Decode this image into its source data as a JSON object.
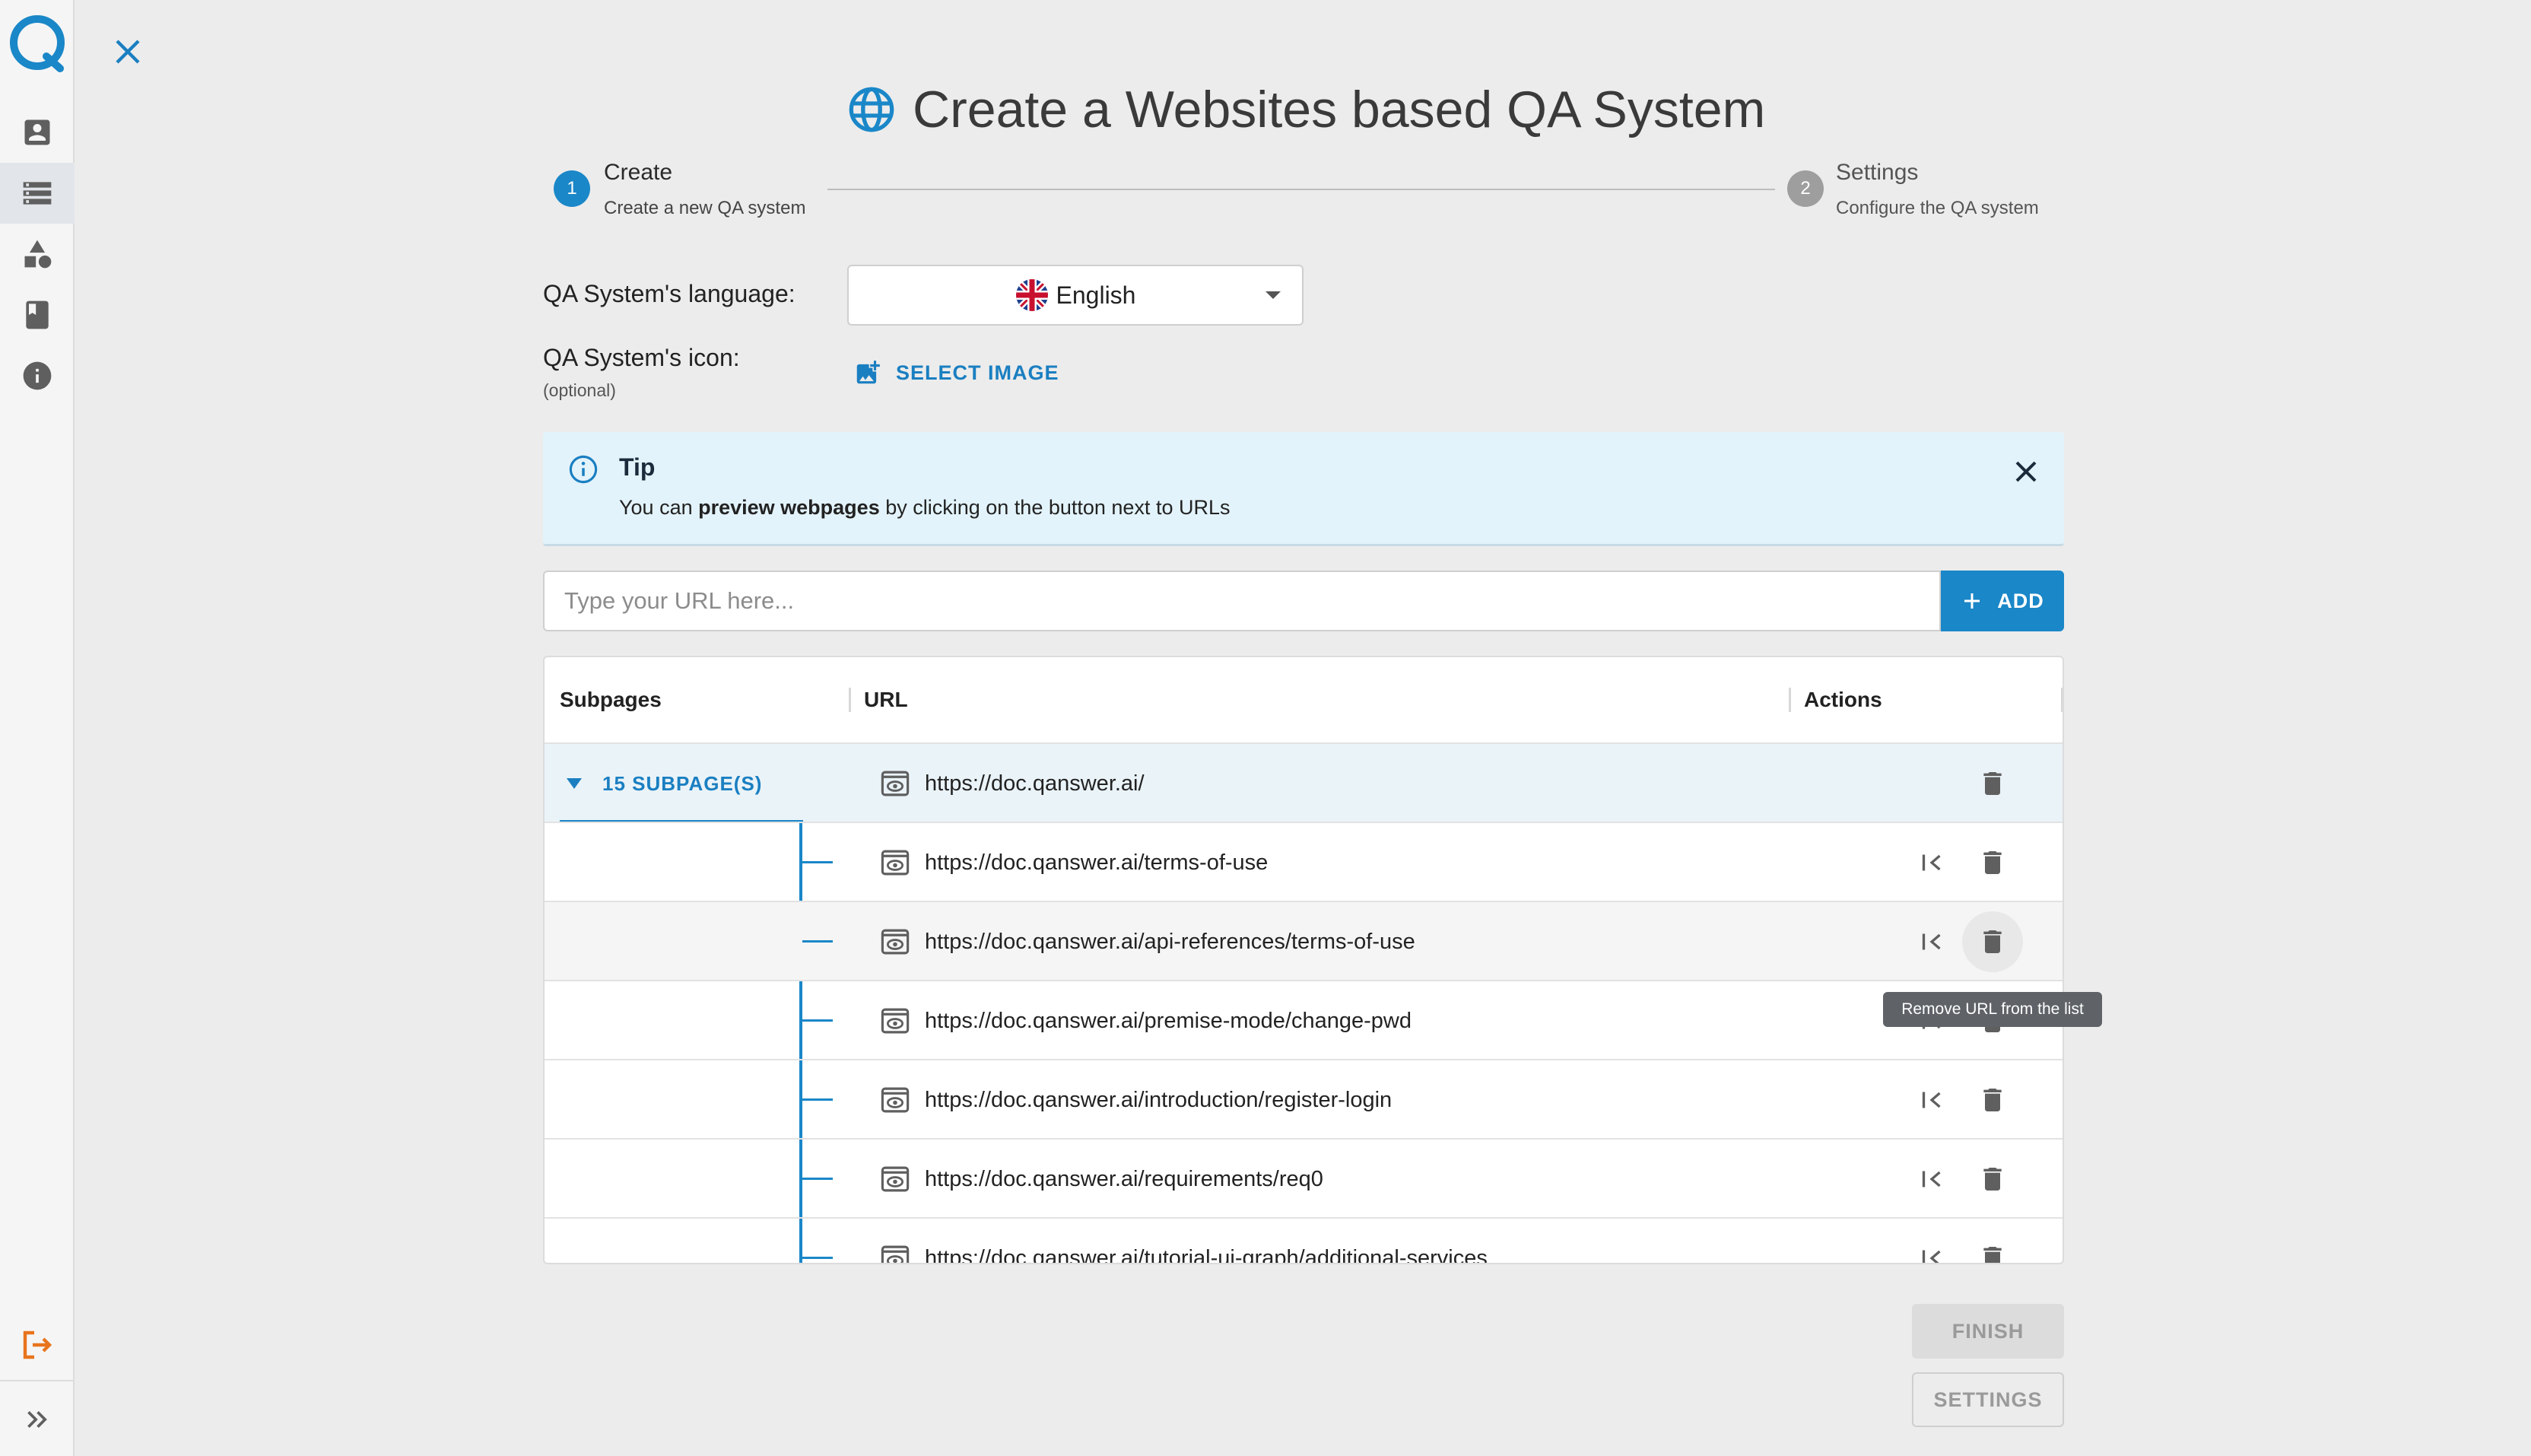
{
  "header": {
    "title": "Create a Websites based QA System"
  },
  "stepper": {
    "steps": [
      {
        "number": "1",
        "label": "Create",
        "sub": "Create a new QA system",
        "state": "active"
      },
      {
        "number": "2",
        "label": "Settings",
        "sub": "Configure the QA system",
        "state": "inactive"
      }
    ]
  },
  "form": {
    "language_label": "QA System's language:",
    "language_value": "English",
    "icon_label": "QA System's icon:",
    "icon_hint": "(optional)",
    "select_image_label": "SELECT IMAGE"
  },
  "tip": {
    "title": "Tip",
    "text_before": "You can ",
    "text_bold": "preview webpages",
    "text_after": " by clicking on the button next to URLs"
  },
  "url_input": {
    "placeholder": "Type your URL here...",
    "value": "",
    "add_label": "ADD"
  },
  "table": {
    "headers": {
      "subpages": "Subpages",
      "url": "URL",
      "actions": "Actions"
    },
    "subpages_toggle": "15 SUBPAGE(S)",
    "root_url": "https://doc.qanswer.ai/",
    "rows": [
      "https://doc.qanswer.ai/terms-of-use",
      "https://doc.qanswer.ai/api-references/terms-of-use",
      "https://doc.qanswer.ai/premise-mode/change-pwd",
      "https://doc.qanswer.ai/introduction/register-login",
      "https://doc.qanswer.ai/requirements/req0",
      "https://doc.qanswer.ai/tutorial-ui-graph/additional-services"
    ]
  },
  "tooltip": "Remove URL from the list",
  "buttons": {
    "finish": "FINISH",
    "settings": "SETTINGS"
  },
  "colors": {
    "accent": "#1a87c8",
    "logout": "#e8741d",
    "step_inactive": "#9e9e9e"
  },
  "icons": {
    "sidebar": [
      "account-box-icon",
      "storage-icon",
      "category-icon",
      "book-icon",
      "info-icon",
      "logout-icon",
      "expand-icon"
    ],
    "row_actions": [
      "preview-icon",
      "move-to-root-icon",
      "delete-icon"
    ]
  }
}
